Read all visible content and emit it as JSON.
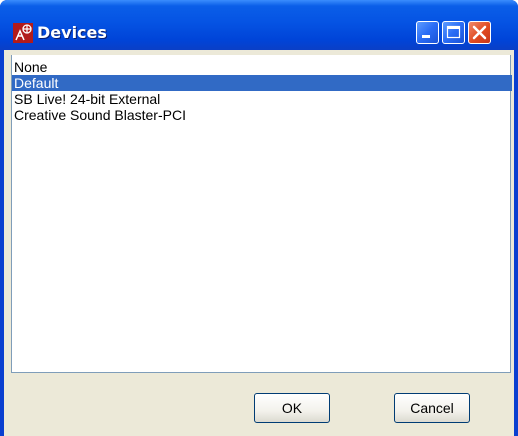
{
  "window": {
    "title": "Devices"
  },
  "devices": {
    "items": [
      "None",
      "Default",
      "SB Live! 24-bit External",
      "Creative Sound Blaster-PCI"
    ],
    "selected": "Default"
  },
  "buttons": {
    "ok": "OK",
    "cancel": "Cancel"
  },
  "colors": {
    "titlebar": "#0553e3",
    "selection": "#316ac5",
    "dialog_bg": "#ece9d8",
    "close_button": "#e04a20"
  },
  "icons": [
    "app-icon",
    "minimize-icon",
    "maximize-icon",
    "close-icon"
  ]
}
